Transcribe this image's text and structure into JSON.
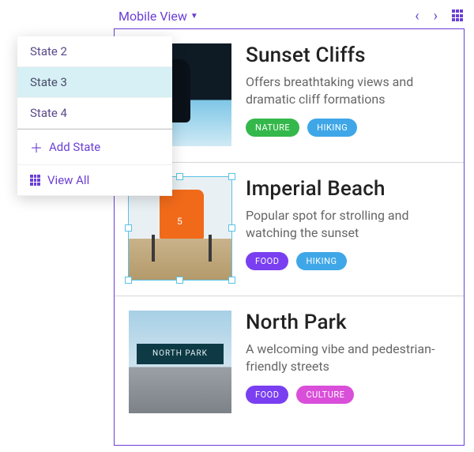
{
  "topbar": {
    "view_label": "Mobile View"
  },
  "state_panel": {
    "items": [
      {
        "label": "State 2",
        "selected": false
      },
      {
        "label": "State 3",
        "selected": true
      },
      {
        "label": "State 4",
        "selected": false
      }
    ],
    "add_label": "Add State",
    "view_all_label": "View All"
  },
  "cards": [
    {
      "title": "Sunset Cliffs",
      "desc": "Offers breathtaking views and dramatic cliff formations",
      "tags": [
        {
          "label": "NATURE",
          "color": "#35b84b"
        },
        {
          "label": "HIKING",
          "color": "#3fa7e8"
        }
      ],
      "selected": false
    },
    {
      "title": "Imperial Beach",
      "desc": "Popular spot for strolling and watching the sunset",
      "tags": [
        {
          "label": "FOOD",
          "color": "#7a3ff0"
        },
        {
          "label": "HIKING",
          "color": "#3fa7e8"
        }
      ],
      "selected": true,
      "thumb_number": "5"
    },
    {
      "title": "North Park",
      "desc": "A welcoming vibe and pedestrian-friendly streets",
      "tags": [
        {
          "label": "FOOD",
          "color": "#7a3ff0"
        },
        {
          "label": "CULTURE",
          "color": "#d94fd9"
        }
      ],
      "selected": false,
      "sign_text": "NORTH PARK"
    }
  ]
}
